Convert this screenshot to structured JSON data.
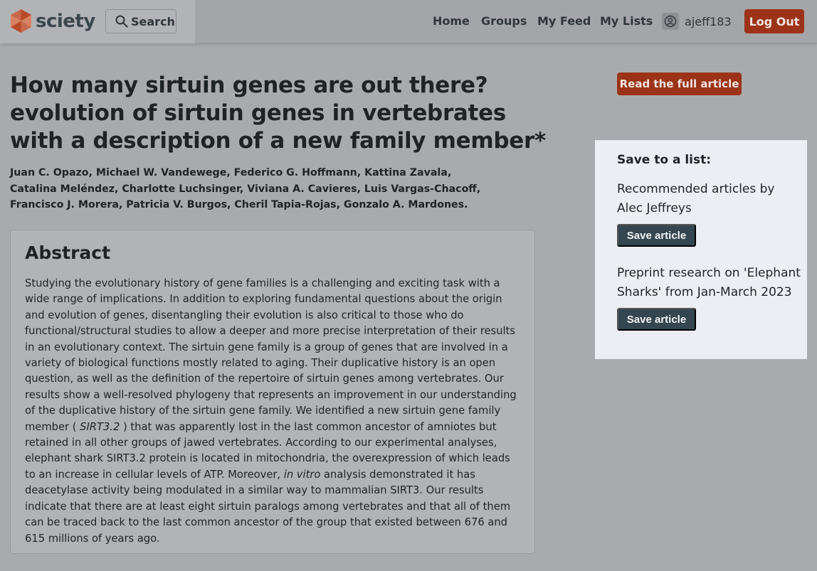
{
  "header": {
    "logo_text": "sciety",
    "search_label": "Search",
    "nav": {
      "home": "Home",
      "groups": "Groups",
      "feed": "My Feed",
      "lists": "My Lists"
    },
    "username": "ajeff183",
    "logout_label": "Log Out"
  },
  "article": {
    "title": "How many sirtuin genes are out there? evolution of sirtuin genes in vertebrates with a description of a new family member*",
    "authors": "Juan C. Opazo, Michael W. Vandewege, Federico G. Hoffmann, Kattina Zavala, Catalina Meléndez, Charlotte Luchsinger, Viviana A. Cavieres, Luis Vargas-Chacoff, Francisco J. Morera, Patricia V. Burgos, Cheril Tapia-Rojas, Gonzalo A. Mardones.",
    "abstract_heading": "Abstract",
    "abstract": {
      "part1": "Studying the evolutionary history of gene families is a challenging and exciting task with a wide range of implications. In addition to exploring fundamental questions about the origin and evolution of genes, disentangling their evolution is also critical to those who do functional/structural studies to allow a deeper and more precise interpretation of their results in an evolutionary context. The sirtuin gene family is a group of genes that are involved in a variety of biological functions mostly related to aging. Their duplicative history is an open question, as well as the definition of the repertoire of sirtuin genes among vertebrates. Our results show a well-resolved phylogeny that represents an improvement in our understanding of the duplicative history of the sirtuin gene family. We identified a new sirtuin gene family member ( ",
      "gene": "SIRT3.2",
      "part2": " ) that was apparently lost in the last common ancestor of amniotes but retained in all other groups of jawed vertebrates. According to our experimental analyses, elephant shark SIRT3.2 protein is located in mitochondria, the overexpression of which leads to an increase in cellular levels of ATP. Moreover, ",
      "in_vitro": "in vitro",
      "part3": " analysis demonstrated it has deacetylase activity being modulated in a similar way to mammalian SIRT3. Our results indicate that there are at least eight sirtuin paralogs among vertebrates and that all of them can be traced back to the last common ancestor of the group that existed between 676 and 615 millions of years ago."
    },
    "read_full_label": "Read the full article"
  },
  "save_panel": {
    "heading": "Save to a list:",
    "lists": [
      {
        "name": "Recommended articles by Alec Jeffreys",
        "button": "Save article"
      },
      {
        "name": "Preprint research on 'Elephant Sharks' from Jan-March 2023",
        "button": "Save article"
      }
    ]
  },
  "colors": {
    "brand_orange": "#cf4a26",
    "button_red": "#9c3318",
    "button_dark": "#34464f",
    "overlay_gray": "#a9aaad"
  },
  "icons": [
    "sciety-logo-icon",
    "search-icon",
    "user-avatar-icon"
  ]
}
